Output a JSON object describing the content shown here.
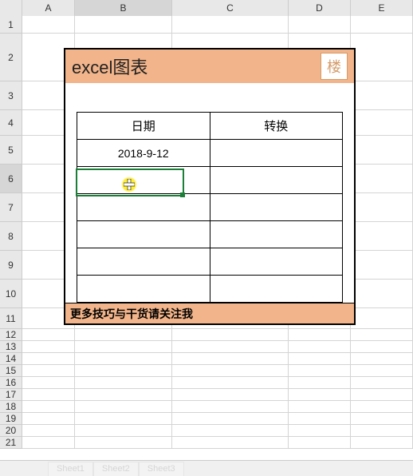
{
  "columns": [
    "A",
    "B",
    "C",
    "D",
    "E"
  ],
  "rows": [
    "1",
    "2",
    "3",
    "4",
    "5",
    "6",
    "7",
    "8",
    "9",
    "10",
    "11",
    "12",
    "13",
    "14",
    "15",
    "16",
    "17",
    "18",
    "19",
    "20",
    "21"
  ],
  "active_cell": "B6",
  "card": {
    "title": "excel图表",
    "logo_glyph": "楼",
    "table": {
      "headers": [
        "日期",
        "转换"
      ],
      "rows": [
        [
          "2018-9-12",
          ""
        ],
        [
          "",
          ""
        ],
        [
          "",
          ""
        ],
        [
          "",
          ""
        ],
        [
          "",
          ""
        ],
        [
          "",
          ""
        ]
      ]
    },
    "footer": "更多技巧与干货请关注我"
  },
  "sheet_tabs": [
    "Sheet1",
    "Sheet2",
    "Sheet3"
  ]
}
